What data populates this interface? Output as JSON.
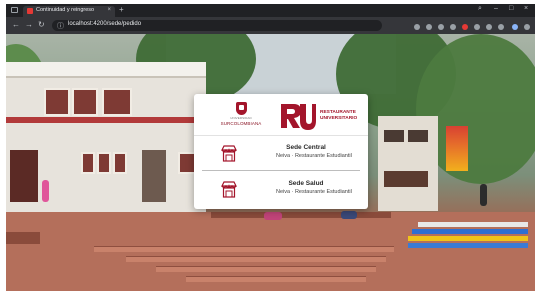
{
  "browser": {
    "tab_title": "Continuidad y reingreso",
    "tab_close": "×",
    "new_tab": "+",
    "url": "localhost:4200/sede/pedido",
    "info_glyph": "ⓘ",
    "controls": {
      "minimize": "–",
      "maximize": "□",
      "close": "×",
      "search": "⌕"
    },
    "nav": {
      "back": "←",
      "forward": "→",
      "reload": "↻"
    }
  },
  "modal": {
    "university_name": "SURCOLOMBIANA",
    "university_small": "UNIVERSIDAD",
    "restaurant_logo_text": [
      "RESTAURANTE",
      "UNIVERSITARIO"
    ],
    "sedes": [
      {
        "name": "Sede Central",
        "subtitle": "Neiva · Restaurante Estudiantil"
      },
      {
        "name": "Sede Salud",
        "subtitle": "Neiva · Restaurante Estudiantil"
      }
    ]
  },
  "colors": {
    "brand": "#a3152b",
    "browser_bg": "#202124",
    "toolbar_bg": "#35363a"
  },
  "icons": [
    "window-icon",
    "favicon-icon",
    "info-icon",
    "stall-icon",
    "shield-icon"
  ]
}
